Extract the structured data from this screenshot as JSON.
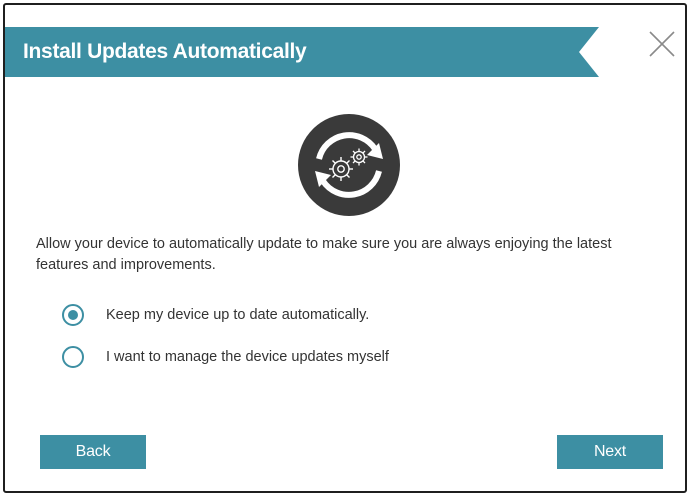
{
  "dialog": {
    "title": "Install Updates Automatically",
    "close_icon": "close-icon",
    "illustration_icon": "auto-update-gears-icon",
    "description": "Allow your device to automatically update to make sure you are always enjoying the latest features and improvements.",
    "options": [
      {
        "label": "Keep my device up to date automatically.",
        "selected": true
      },
      {
        "label": "I want to manage the device updates myself",
        "selected": false
      }
    ],
    "back_label": "Back",
    "next_label": "Next"
  },
  "colors": {
    "accent": "#3d8fa3",
    "text": "#333333",
    "icon_dark": "#3a3a3a",
    "border": "#1f1f1f"
  }
}
